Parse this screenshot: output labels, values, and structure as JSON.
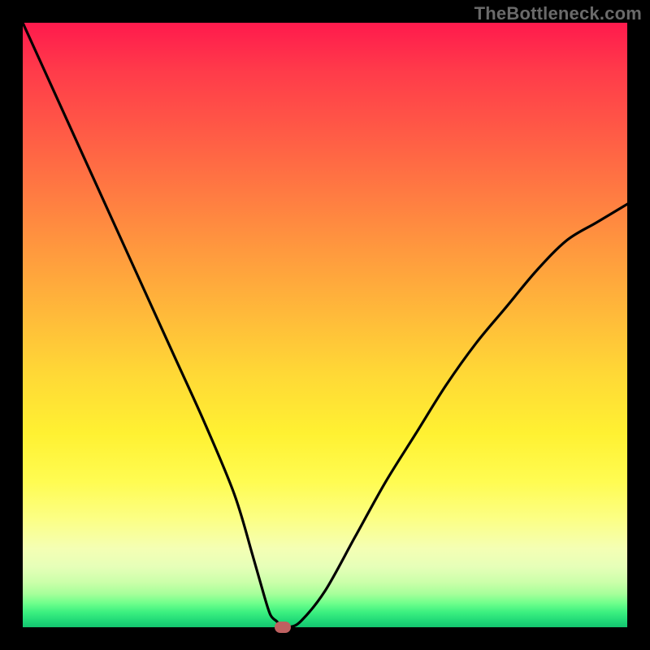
{
  "watermark": "TheBottleneck.com",
  "colors": {
    "frame": "#000000",
    "curve": "#000000",
    "marker": "#be6060"
  },
  "chart_data": {
    "type": "line",
    "title": "",
    "xlabel": "",
    "ylabel": "",
    "xlim": [
      0,
      100
    ],
    "ylim": [
      0,
      100
    ],
    "grid": false,
    "legend": false,
    "annotations": [
      {
        "text_ref": "watermark",
        "position": "top-right"
      }
    ],
    "series": [
      {
        "name": "bottleneck-curve",
        "x": [
          0,
          5,
          10,
          15,
          20,
          25,
          30,
          35,
          38,
          40,
          41,
          42,
          43,
          44,
          46,
          50,
          55,
          60,
          65,
          70,
          75,
          80,
          85,
          90,
          95,
          100
        ],
        "values": [
          100,
          89,
          78,
          67,
          56,
          45,
          34,
          22,
          12,
          5,
          2,
          1,
          0,
          0,
          1,
          6,
          15,
          24,
          32,
          40,
          47,
          53,
          59,
          64,
          67,
          70
        ]
      }
    ],
    "marker": {
      "x": 43,
      "y": 0
    }
  }
}
